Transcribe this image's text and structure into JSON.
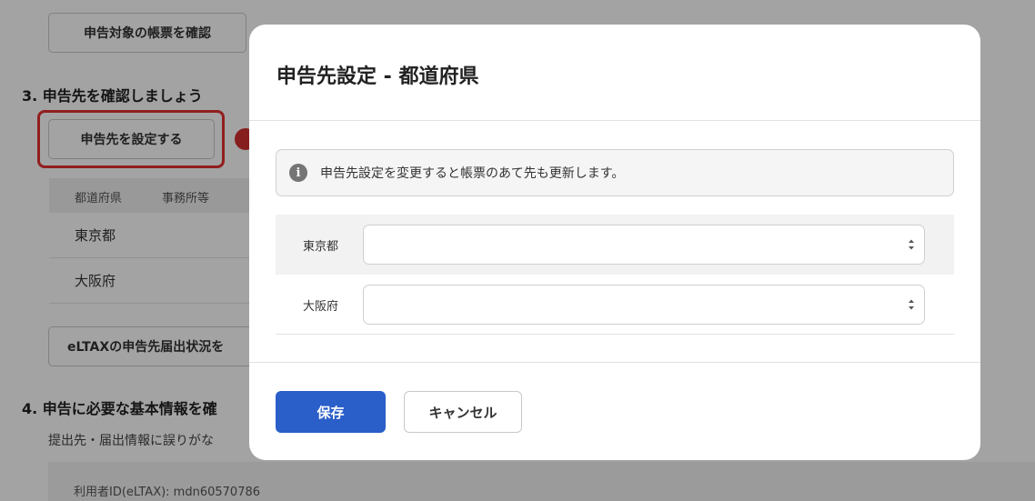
{
  "background": {
    "confirm_forms_button": "申告対象の帳票を確認",
    "section3_heading": "3. 申告先を確認しましょう",
    "set_destination_button": "申告先を設定する",
    "table": {
      "headers": [
        "都道府県",
        "事務所等"
      ],
      "rows": [
        "東京都",
        "大阪府"
      ]
    },
    "eltax_status_button": "eLTAXの申告先届出状況を",
    "section4_heading": "4. 申告に必要な基本情報を確",
    "section4_desc": "提出先・届出情報に誤りがな",
    "user_id_partial": "利用者ID(eLTAX): mdn60570786"
  },
  "modal": {
    "title": "申告先設定 - 都道府県",
    "notice": "申告先設定を変更すると帳票のあて先も更新します。",
    "notice_icon": "info-icon",
    "rows": [
      {
        "label": "東京都",
        "selected_value": ""
      },
      {
        "label": "大阪府",
        "selected_value": ""
      }
    ],
    "save_button": "保存",
    "cancel_button": "キャンセル"
  },
  "colors": {
    "primary": "#2a5ec9",
    "highlight": "#e53030",
    "badge": "#d23030",
    "overlay": "rgba(0,0,0,0.36)"
  }
}
